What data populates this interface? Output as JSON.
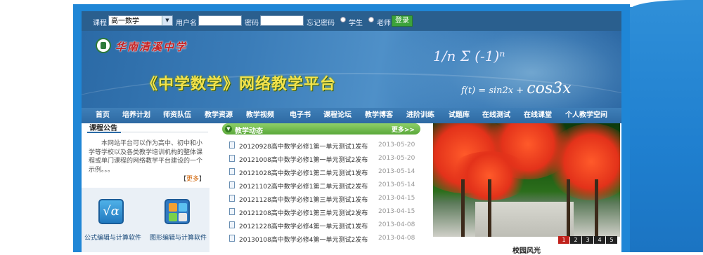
{
  "login_bar": {
    "course_label": "课程",
    "course_selected": "高一数学",
    "username_label": "用户名",
    "password_label": "密码",
    "forgot_password": "忘记密码",
    "role_student": "学生",
    "role_teacher": "老师",
    "login_button": "登录"
  },
  "banner": {
    "school_name": "华南清溪中学",
    "platform_title": "《中学数学》网络教学平台",
    "formula_top": "1/n Σ (-1)ⁿ",
    "formula_bottom_a": "f(t) = sin2x + ",
    "formula_bottom_b": "cos3x"
  },
  "nav": [
    "首页",
    "培养计划",
    "师资队伍",
    "教学资源",
    "教学视频",
    "电子书",
    "课程论坛",
    "教学博客",
    "进阶训练",
    "试题库",
    "在线测试",
    "在线课堂",
    "个人教学空间"
  ],
  "announcement": {
    "title": "课程公告",
    "text": "本网站平台可以作为高中、初中和小学等学校以及各类教学培训机构的整体课程或单门课程的网络教学平台建设的一个示例。。。",
    "more_left": "【",
    "more_label": "更多",
    "more_right": "】"
  },
  "tools": [
    {
      "label": "公式编辑与计算软件",
      "icon": "formula-icon"
    },
    {
      "label": "图形编辑与计算软件",
      "icon": "graphics-icon"
    }
  ],
  "news": {
    "title": "教学动态",
    "more": "更多>>",
    "items": [
      {
        "title": "20120928高中数学必修1第一单元测试1发布",
        "date": "2013-05-20"
      },
      {
        "title": "20121008高中数学必修1第一单元测试2发布",
        "date": "2013-05-20"
      },
      {
        "title": "20121028高中数学必修1第二单元测试1发布",
        "date": "2013-05-14"
      },
      {
        "title": "20121102高中数学必修1第二单元测试2发布",
        "date": "2013-05-14"
      },
      {
        "title": "20121128高中数学必修1第三单元测试1发布",
        "date": "2013-04-15"
      },
      {
        "title": "20121208高中数学必修1第三单元测试2发布",
        "date": "2013-04-15"
      },
      {
        "title": "20121228高中数学必修4第一单元测试1发布",
        "date": "2013-04-08"
      },
      {
        "title": "20130108高中数学必修4第一单元测试2发布",
        "date": "2013-04-08"
      }
    ]
  },
  "photo": {
    "caption": "校园风光",
    "pages": [
      "1",
      "2",
      "3",
      "4",
      "5"
    ]
  },
  "colors": {
    "frame_blue": "#1f86d6",
    "nav_blue": "#2e6aa3",
    "news_green": "#5aa83a",
    "accent_red": "#c0201a"
  }
}
